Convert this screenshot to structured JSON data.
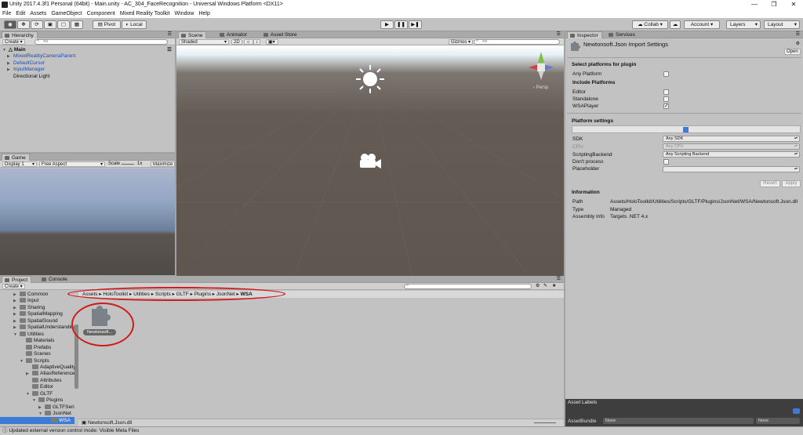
{
  "window": {
    "title": "Unity 2017.4.3f1 Personal (64bit) - Main.unity - AC_304_FaceRecognition - Universal Windows Platform <DX11>",
    "minimize": "—",
    "restore": "❐",
    "close": "✕"
  },
  "menu": [
    "File",
    "Edit",
    "Assets",
    "GameObject",
    "Component",
    "Mixed Reality Toolkit",
    "Window",
    "Help"
  ],
  "toolbar": {
    "pivot": "Pivot",
    "local": "Local",
    "collab": "Collab ▾",
    "account": "Account ▾",
    "layers": "Layers",
    "layout": "Layout",
    "play": "▶",
    "pause": "❚❚",
    "step": "▶❚"
  },
  "hierarchy": {
    "tab": "Hierarchy",
    "create": "Create",
    "search": "All",
    "scene": "Main",
    "items": [
      {
        "label": "MixedRealityCameraParent",
        "prefab": true
      },
      {
        "label": "DefaultCursor",
        "prefab": true
      },
      {
        "label": "InputManager",
        "prefab": true
      },
      {
        "label": "Directional Light",
        "prefab": false
      }
    ]
  },
  "scene": {
    "tabs": [
      "Scene",
      "Animator",
      "Asset Store"
    ],
    "shading": "Shaded",
    "mode2d": "2D",
    "gizmos": "Gizmos",
    "search": "All",
    "persp": "‹ Persp"
  },
  "game": {
    "tab": "Game",
    "display": "Display 1",
    "aspect": "Free Aspect",
    "scale": "Scale",
    "scale_value": "1x",
    "maximize": "Maximize O"
  },
  "project": {
    "tabs": [
      "Project",
      "Console"
    ],
    "create": "Create",
    "breadcrumb": [
      "Assets",
      "HoloToolkit",
      "Utilities",
      "Scripts",
      "GLTF",
      "Plugins",
      "JsonNet",
      "WSA"
    ],
    "tree": [
      {
        "label": "Common",
        "depth": 0,
        "expand": "▶"
      },
      {
        "label": "Input",
        "depth": 0,
        "expand": "▶"
      },
      {
        "label": "Sharing",
        "depth": 0,
        "expand": "▶"
      },
      {
        "label": "SpatialMapping",
        "depth": 0,
        "expand": "▶"
      },
      {
        "label": "SpatialSound",
        "depth": 0,
        "expand": "▶"
      },
      {
        "label": "SpatialUnderstanding",
        "depth": 0,
        "expand": "▶"
      },
      {
        "label": "Utilities",
        "depth": 0,
        "expand": "▼"
      },
      {
        "label": "Materials",
        "depth": 1,
        "expand": ""
      },
      {
        "label": "Prefabs",
        "depth": 1,
        "expand": ""
      },
      {
        "label": "Scenes",
        "depth": 1,
        "expand": ""
      },
      {
        "label": "Scripts",
        "depth": 1,
        "expand": "▼"
      },
      {
        "label": "AdaptiveQuality",
        "depth": 2,
        "expand": ""
      },
      {
        "label": "AtlasReference",
        "depth": 2,
        "expand": "▶"
      },
      {
        "label": "Attributes",
        "depth": 2,
        "expand": ""
      },
      {
        "label": "Editor",
        "depth": 2,
        "expand": ""
      },
      {
        "label": "GLTF",
        "depth": 2,
        "expand": "▼"
      },
      {
        "label": "Plugins",
        "depth": 3,
        "expand": "▼"
      },
      {
        "label": "GLTFSeria",
        "depth": 4,
        "expand": "▶"
      },
      {
        "label": "JsonNet",
        "depth": 4,
        "expand": "▼"
      },
      {
        "label": "WSA",
        "depth": 5,
        "expand": "",
        "selected": true
      }
    ],
    "asset_label": "Newtonsoft...",
    "footer_file": "Newtonsoft.Json.dll"
  },
  "inspector": {
    "tabs": [
      "Inspector",
      "Services"
    ],
    "title": "Newtonsoft.Json Import Settings",
    "open": "Open",
    "select_platforms": "Select platforms for plugin",
    "any_platform": "Any Platform",
    "include_platforms": "Include Platforms",
    "platforms": [
      {
        "label": "Editor",
        "checked": false
      },
      {
        "label": "Standalone",
        "checked": false
      },
      {
        "label": "WSAPlayer",
        "checked": true
      }
    ],
    "platform_settings": "Platform settings",
    "settings": [
      {
        "label": "SDK",
        "value": "Any SDK",
        "type": "dropdown",
        "disabled": false
      },
      {
        "label": "CPU",
        "value": "Any CPU",
        "type": "dropdown",
        "disabled": true
      },
      {
        "label": "ScriptingBackend",
        "value": "Any Scripting Backend",
        "type": "dropdown",
        "disabled": false
      },
      {
        "label": "Don't process",
        "value": "",
        "type": "checkbox",
        "disabled": false
      },
      {
        "label": "Placeholder",
        "value": "",
        "type": "dropdown",
        "disabled": false
      }
    ],
    "revert": "Revert",
    "apply": "Apply",
    "information": "Information",
    "info": [
      {
        "label": "Path",
        "value": "Assets/HoloToolkit/Utilities/Scripts/GLTF/Plugins/JsonNet/WSA/Newtonsoft.Json.dll"
      },
      {
        "label": "Type",
        "value": "Managed"
      },
      {
        "label": "Assembly Info",
        "value": "Targets .NET 4.x"
      }
    ],
    "asset_labels": "Asset Labels",
    "asset_bundle": "AssetBundle",
    "bundle_none_1": "None",
    "bundle_none_2": "None"
  },
  "status": {
    "message": "Updated external version control mode: Visible Meta Files"
  },
  "colors": {
    "accent_blue": "#3d7bd8",
    "annotation_red": "#d21a1a",
    "prefab_blue": "#1a4fb8"
  }
}
